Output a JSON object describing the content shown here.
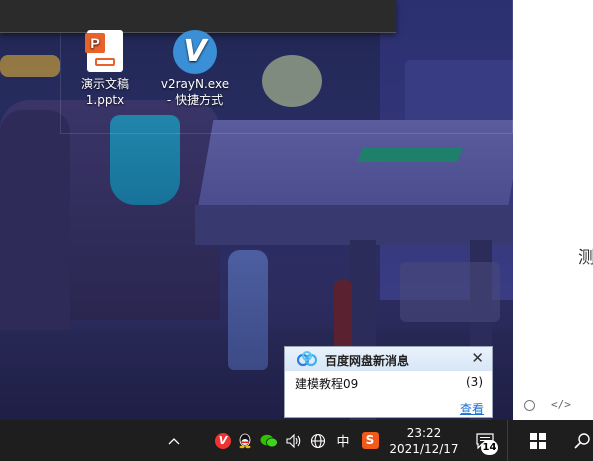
{
  "desktop": {
    "icons": [
      {
        "label_line1": "演示文稿",
        "label_line2": "1.pptx",
        "icon": "pptx-file-icon"
      },
      {
        "label_line1": "v2rayN.exe",
        "label_line2": "- 快捷方式",
        "icon": "v2rayn-app-icon"
      }
    ]
  },
  "right_panel": {
    "text": "测",
    "icons": [
      "circle-icon",
      "code-icon"
    ],
    "code_glyph": "</>"
  },
  "notification": {
    "title": "百度网盘新消息",
    "close_glyph": "✕",
    "item_name": "建模教程09",
    "item_count": "(3)",
    "view_link": "查看",
    "logo": "baidu-netdisk-logo"
  },
  "taskbar": {
    "chevron": "^",
    "tray_icons": [
      "v2rayn-tray-icon",
      "qq-icon",
      "wechat-icon",
      "volume-icon",
      "network-icon",
      "ime-icon",
      "sogou-icon"
    ],
    "ime_label": "中",
    "sogou_label": "S",
    "clock_time": "23:22",
    "clock_date": "2021/12/17",
    "notification_count": "14",
    "start_icon": "windows-start-icon",
    "search_icon": "search-icon"
  },
  "colors": {
    "taskbar_bg": "#1e1e1e",
    "notify_link": "#1a6fd1",
    "pptx_orange": "#e8622c",
    "v2ray_blue": "#3a8fd6"
  }
}
